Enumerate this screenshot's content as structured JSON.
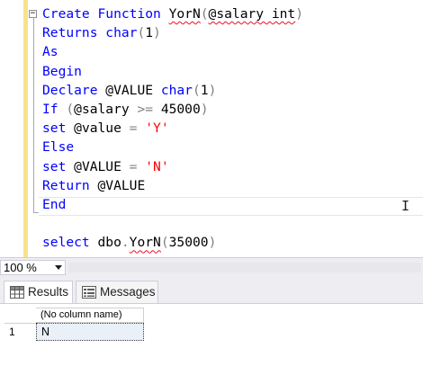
{
  "editor": {
    "collapse_glyph": "−",
    "lines": [
      {
        "parts": [
          {
            "t": "Create Function ",
            "c": "kw"
          },
          {
            "t": "YorN",
            "c": "plain",
            "sq": true
          },
          {
            "t": "(",
            "c": "op"
          },
          {
            "t": "@salary int",
            "c": "plain",
            "sq": true
          },
          {
            "t": ")",
            "c": "op"
          }
        ]
      },
      {
        "parts": [
          {
            "t": "Returns ",
            "c": "kw"
          },
          {
            "t": "char",
            "c": "kw"
          },
          {
            "t": "(",
            "c": "op"
          },
          {
            "t": "1",
            "c": "plain"
          },
          {
            "t": ")",
            "c": "op"
          }
        ]
      },
      {
        "parts": [
          {
            "t": "As",
            "c": "kw"
          }
        ]
      },
      {
        "parts": [
          {
            "t": "Begin",
            "c": "kw"
          }
        ]
      },
      {
        "parts": [
          {
            "t": "Declare ",
            "c": "kw"
          },
          {
            "t": "@VALUE ",
            "c": "plain"
          },
          {
            "t": "char",
            "c": "kw"
          },
          {
            "t": "(",
            "c": "op"
          },
          {
            "t": "1",
            "c": "plain"
          },
          {
            "t": ")",
            "c": "op"
          }
        ]
      },
      {
        "parts": [
          {
            "t": "If ",
            "c": "kw"
          },
          {
            "t": "(",
            "c": "op"
          },
          {
            "t": "@salary ",
            "c": "plain"
          },
          {
            "t": ">=",
            "c": "op"
          },
          {
            "t": " 45000",
            "c": "plain"
          },
          {
            "t": ")",
            "c": "op"
          }
        ]
      },
      {
        "parts": [
          {
            "t": "set ",
            "c": "kw"
          },
          {
            "t": "@value ",
            "c": "plain"
          },
          {
            "t": "=",
            "c": "op"
          },
          {
            "t": " ",
            "c": "plain"
          },
          {
            "t": "'Y'",
            "c": "str"
          }
        ]
      },
      {
        "parts": [
          {
            "t": "Else",
            "c": "kw"
          }
        ]
      },
      {
        "parts": [
          {
            "t": "set ",
            "c": "kw"
          },
          {
            "t": "@VALUE ",
            "c": "plain"
          },
          {
            "t": "=",
            "c": "op"
          },
          {
            "t": " ",
            "c": "plain"
          },
          {
            "t": "'N'",
            "c": "str"
          }
        ]
      },
      {
        "parts": [
          {
            "t": "Return ",
            "c": "kw"
          },
          {
            "t": "@VALUE",
            "c": "plain"
          }
        ]
      },
      {
        "parts": [
          {
            "t": "End",
            "c": "kw"
          }
        ]
      },
      {
        "parts": []
      },
      {
        "parts": [
          {
            "t": "select ",
            "c": "kw"
          },
          {
            "t": "dbo",
            "c": "plain"
          },
          {
            "t": ".",
            "c": "op"
          },
          {
            "t": "YorN",
            "c": "plain",
            "sq": true
          },
          {
            "t": "(",
            "c": "op"
          },
          {
            "t": "35000",
            "c": "plain"
          },
          {
            "t": ")",
            "c": "op"
          }
        ]
      }
    ]
  },
  "zoom": {
    "value": "100 %"
  },
  "tabs": {
    "results": "Results",
    "messages": "Messages"
  },
  "grid": {
    "column_header": "(No column name)",
    "rows": [
      {
        "row_number": "1",
        "value": "N"
      }
    ]
  },
  "colors": {
    "keyword": "#0000ff",
    "string": "#ff0000",
    "operator": "#808080",
    "change_bar": "#f6e38a",
    "selected_cell": "#e9f0f8"
  }
}
